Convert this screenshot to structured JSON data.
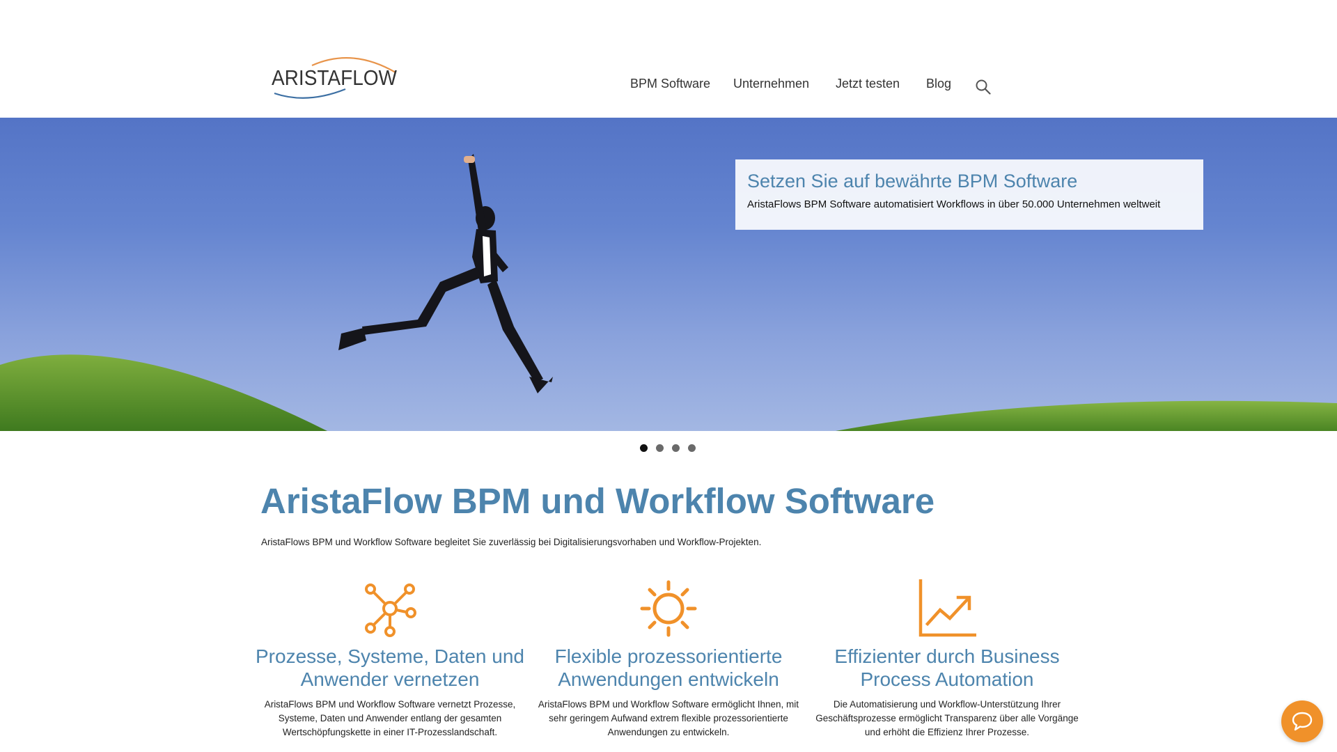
{
  "brand": {
    "logo_text": "ARISTAFLOW",
    "accent_color": "#f0912a",
    "title_color": "#4d84ad"
  },
  "nav": {
    "items": [
      {
        "label": "BPM Software"
      },
      {
        "label": "Unternehmen"
      },
      {
        "label": "Jetzt testen"
      },
      {
        "label": "Blog"
      }
    ],
    "search_icon": "search-icon"
  },
  "hero": {
    "title": "Setzen Sie auf bewährte BPM Software",
    "subtitle": "AristaFlows BPM Software automatisiert Workflows in über 50.000 Unternehmen weltweit"
  },
  "slider": {
    "slide_count": 4,
    "active_index": 0
  },
  "main": {
    "title": "AristaFlow BPM und Workflow Software",
    "subtitle": "AristaFlows BPM und Workflow Software begleitet Sie zuverlässig bei Digitalisierungsvorhaben und Workflow-Projekten."
  },
  "features": [
    {
      "icon": "network-icon",
      "title": "Prozesse, Systeme, Daten und Anwender vernetzen",
      "text": "AristaFlows BPM und Workflow Software vernetzt Prozesse, Systeme, Daten und Anwender entlang der gesamten Wertschöpfungskette in einer IT-Prozesslandschaft."
    },
    {
      "icon": "sun-icon",
      "title": "Flexible prozessorientierte Anwendungen entwickeln",
      "text": "AristaFlows BPM und Workflow Software ermöglicht Ihnen, mit sehr geringem Aufwand extrem flexible prozessorientierte Anwendungen zu entwickeln."
    },
    {
      "icon": "growth-chart-icon",
      "title": "Effizienter durch Business Process Automation",
      "text": "Die Automatisierung und Workflow-Unterstützung Ihrer Geschäftsprozesse ermöglicht Transparenz über alle Vorgänge und erhöht die Effizienz Ihrer Prozesse."
    }
  ],
  "chat": {
    "icon": "chat-bubble-icon"
  }
}
